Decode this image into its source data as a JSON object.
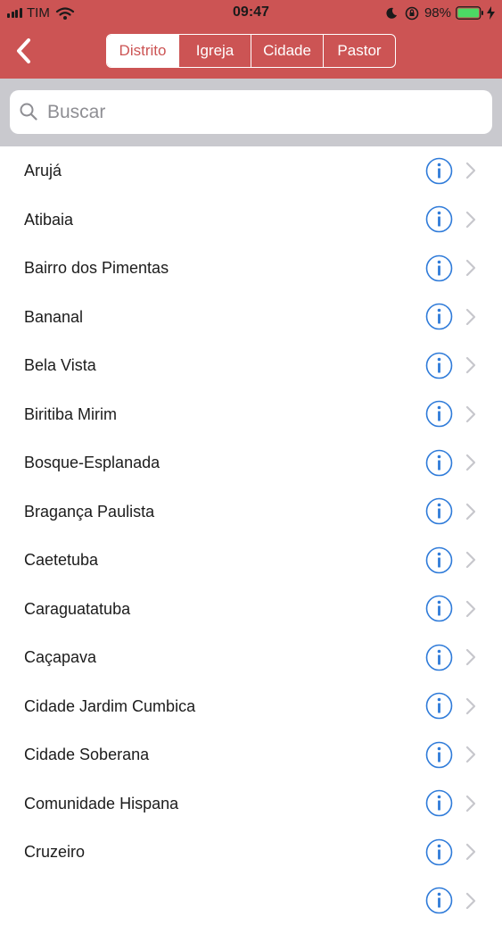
{
  "status_bar": {
    "carrier": "TIM",
    "time": "09:47",
    "battery": "98%"
  },
  "nav": {
    "tabs": [
      {
        "label": "Distrito",
        "active": true
      },
      {
        "label": "Igreja",
        "active": false
      },
      {
        "label": "Cidade",
        "active": false
      },
      {
        "label": "Pastor",
        "active": false
      }
    ]
  },
  "search": {
    "placeholder": "Buscar"
  },
  "list": {
    "items": [
      "Arujá",
      "Atibaia",
      "Bairro dos Pimentas",
      "Bananal",
      "Bela Vista",
      "Biritiba Mirim",
      "Bosque-Esplanada",
      "Bragança Paulista",
      "Caetetuba",
      "Caraguatatuba",
      "Caçapava",
      "Cidade Jardim Cumbica",
      "Cidade Soberana",
      "Comunidade Hispana",
      "Cruzeiro"
    ]
  },
  "colors": {
    "header": "#cc5454",
    "accent_blue": "#2f7bd9",
    "chevron": "#c7c7cc",
    "battery": "#4cd964"
  },
  "icons": {
    "back": "chevron-left-icon",
    "search": "search-icon",
    "info": "info-circle-icon",
    "disclosure": "chevron-right-icon"
  }
}
